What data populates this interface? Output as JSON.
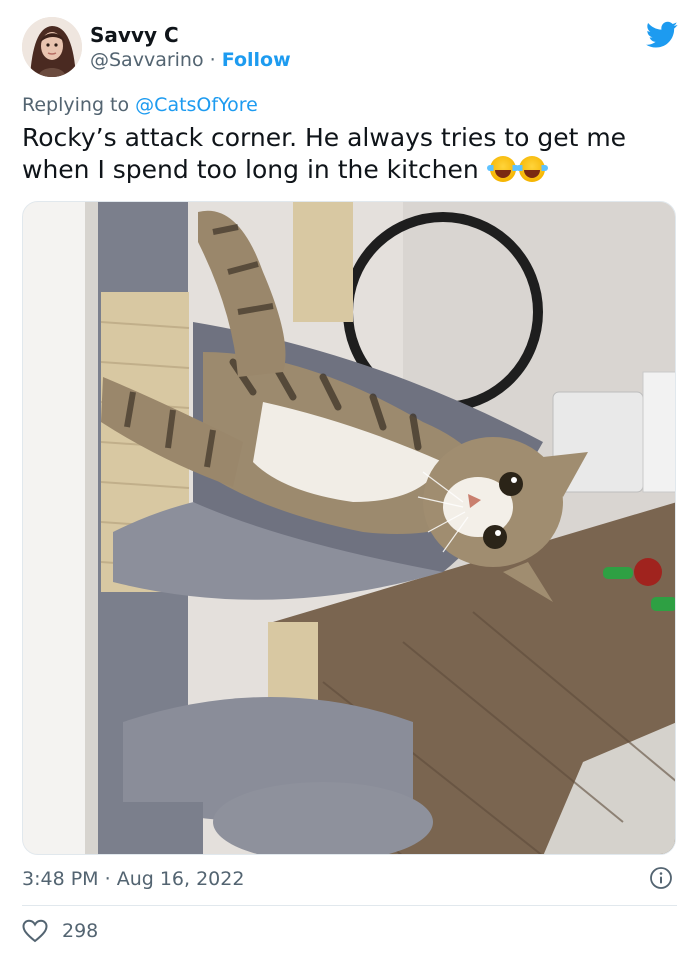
{
  "author": {
    "name": "Savvy C",
    "handle": "@Savvarino",
    "separator": "·",
    "follow_label": "Follow"
  },
  "reply": {
    "prefix": "Replying to",
    "mention": "@CatsOfYore"
  },
  "tweet": {
    "text": "Rocky’s attack corner. He always tries to get me when I spend too long in the kitchen",
    "emojis": [
      "face-with-tears-of-joy",
      "face-with-tears-of-joy"
    ]
  },
  "meta": {
    "time": "3:48 PM",
    "separator": "·",
    "date": "Aug 16, 2022"
  },
  "engagement": {
    "likes": "298"
  },
  "colors": {
    "accent": "#1d9bf0",
    "text": "#0f1419",
    "secondary": "#536471"
  },
  "icons": [
    "twitter-bird-icon",
    "info-icon",
    "heart-icon"
  ]
}
